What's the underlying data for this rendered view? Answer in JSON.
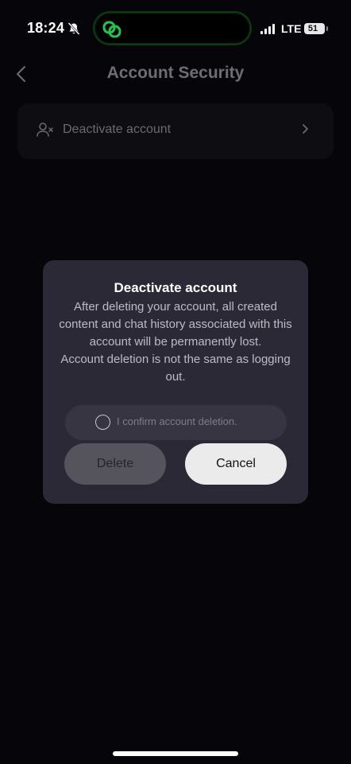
{
  "status_bar": {
    "time": "18:24",
    "network": "LTE",
    "battery": "51",
    "icons": [
      "bell-slash-icon",
      "linked-rings-icon",
      "signal-bars-icon",
      "battery-icon"
    ]
  },
  "header": {
    "title": "Account Security",
    "back_icon": "chevron-left-icon"
  },
  "settings_list": {
    "items": [
      {
        "label": "Deactivate account",
        "icon": "user-remove-icon",
        "trailing_icon": "chevron-right-icon"
      }
    ]
  },
  "dialog": {
    "title": "Deactivate account",
    "message_lines": [
      "After deleting your account, all created content and chat history associated with this account will be permanently lost.",
      "Account deletion is not the same as logging out."
    ],
    "confirm_label": "I confirm account deletion.",
    "confirm_checked": false,
    "delete_label": "Delete",
    "cancel_label": "Cancel"
  },
  "colors": {
    "background": "#060509",
    "dialog_bg": "#2a2935",
    "island_accent": "#22c44e",
    "cancel_bg": "#ebebeb",
    "delete_bg": "#55545d"
  }
}
